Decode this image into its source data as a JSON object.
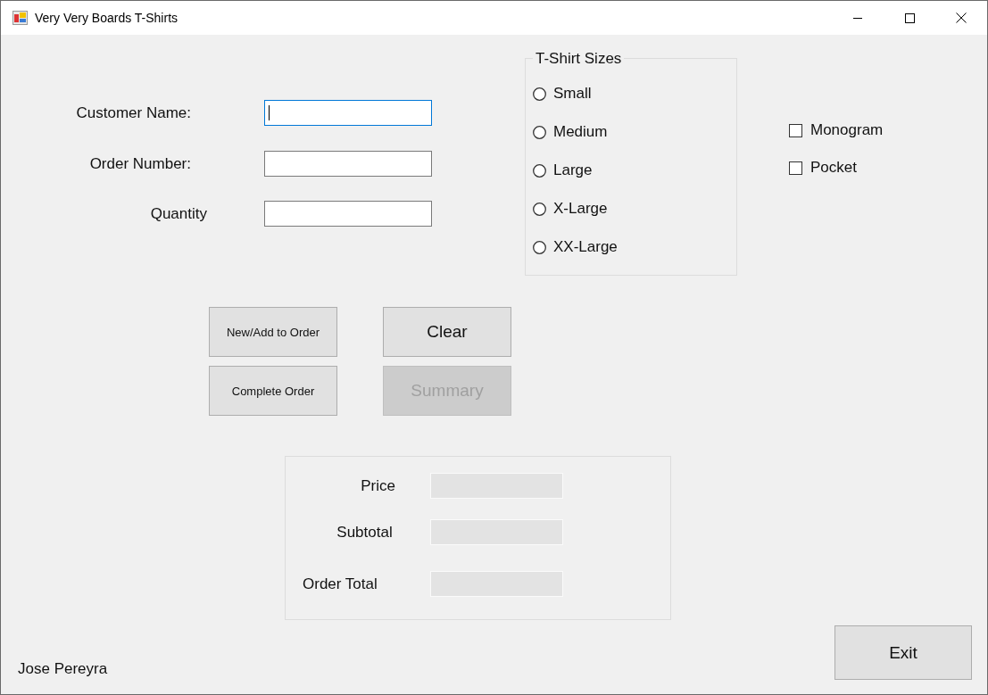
{
  "window": {
    "title": "Very Very Boards T-Shirts"
  },
  "fields": [
    {
      "label": "Customer Name:",
      "focused": true
    },
    {
      "label": "Order Number:",
      "focused": false
    },
    {
      "label": "Quantity",
      "focused": false
    }
  ],
  "size_group": {
    "title": "T-Shirt Sizes",
    "options": [
      {
        "label": "Small",
        "selected": false
      },
      {
        "label": "Medium",
        "selected": false
      },
      {
        "label": "Large",
        "selected": false
      },
      {
        "label": "X-Large",
        "selected": false
      },
      {
        "label": "XX-Large",
        "selected": false
      }
    ]
  },
  "extras": [
    {
      "label": "Monogram",
      "checked": false
    },
    {
      "label": "Pocket",
      "checked": false
    }
  ],
  "buttons": [
    {
      "label": "New/Add to Order",
      "kind": "small",
      "disabled": false
    },
    {
      "label": "Clear",
      "kind": "large",
      "disabled": false
    },
    {
      "label": "Complete Order",
      "kind": "small",
      "disabled": false
    },
    {
      "label": "Summary",
      "kind": "large",
      "disabled": true
    }
  ],
  "totals": [
    {
      "label": "Price"
    },
    {
      "label": "Subtotal"
    },
    {
      "label": "Order Total"
    }
  ],
  "author": "Jose Pereyra",
  "exit_button": {
    "label": "Exit"
  }
}
